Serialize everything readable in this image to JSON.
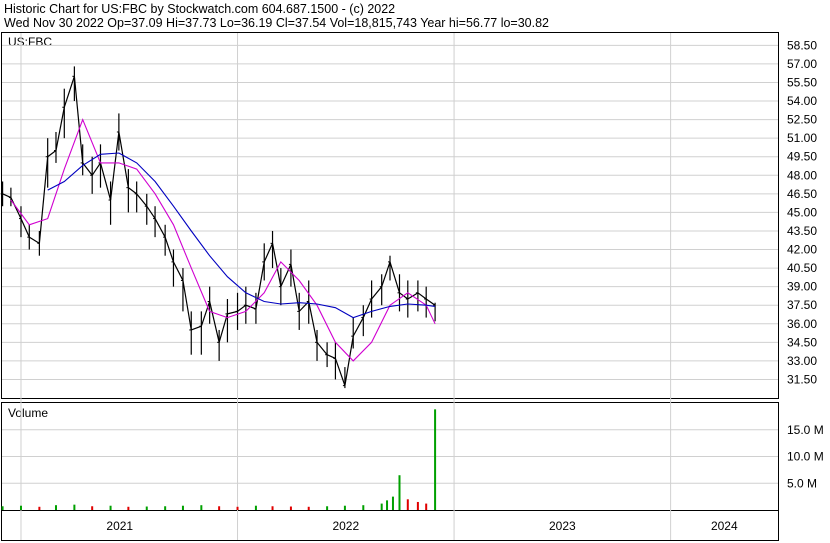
{
  "header": {
    "line1": "Historic Chart for US:FBC by Stockwatch.com 604.687.1500 - (c) 2022",
    "line2": "Wed Nov 30 2022   Op=37.09  Hi=37.73  Lo=36.19  Cl=37.54  Vol=18,815,743  Year hi=56.77  lo=30.82"
  },
  "chart_data": [
    {
      "type": "line",
      "title": "US:FBC",
      "subtype": "daily hi-lo bars with moving averages",
      "x_range": [
        "2020-11-30",
        "2024-06-30"
      ],
      "ylim": [
        30.0,
        59.5
      ],
      "y_ticks": [
        "58.50",
        "57.00",
        "55.50",
        "54.00",
        "52.50",
        "51.00",
        "49.50",
        "48.00",
        "46.50",
        "45.00",
        "43.50",
        "42.00",
        "40.50",
        "39.00",
        "37.50",
        "36.00",
        "34.50",
        "33.00",
        "31.50"
      ],
      "grid": true,
      "series": [
        {
          "style": "hi-lo bars",
          "color": "#000000",
          "x": [
            "2020-12-01",
            "2020-12-15",
            "2021-01-01",
            "2021-01-15",
            "2021-02-01",
            "2021-02-15",
            "2021-03-01",
            "2021-03-15",
            "2021-04-01",
            "2021-04-15",
            "2021-05-01",
            "2021-05-15",
            "2021-06-01",
            "2021-06-15",
            "2021-07-01",
            "2021-07-15",
            "2021-08-01",
            "2021-08-15",
            "2021-09-01",
            "2021-09-15",
            "2021-10-01",
            "2021-10-15",
            "2021-11-01",
            "2021-11-15",
            "2021-12-01",
            "2021-12-15",
            "2022-01-01",
            "2022-01-15",
            "2022-02-01",
            "2022-02-15",
            "2022-03-01",
            "2022-03-15",
            "2022-04-01",
            "2022-04-15",
            "2022-05-01",
            "2022-05-15",
            "2022-06-01",
            "2022-06-15",
            "2022-07-01",
            "2022-07-15",
            "2022-08-01",
            "2022-08-15",
            "2022-09-01",
            "2022-09-15",
            "2022-10-01",
            "2022-10-15",
            "2022-11-01",
            "2022-11-15",
            "2022-11-30"
          ],
          "values": [
            46.5,
            46.2,
            44.5,
            43.0,
            42.5,
            49.5,
            50.0,
            53.5,
            56.0,
            49.0,
            48.0,
            49.0,
            46.0,
            51.5,
            47.0,
            46.5,
            45.5,
            44.5,
            43.0,
            41.0,
            39.5,
            35.5,
            35.8,
            37.8,
            34.5,
            36.8,
            37.0,
            37.5,
            37.2,
            41.0,
            42.5,
            39.0,
            40.8,
            37.0,
            37.8,
            34.5,
            33.5,
            33.2,
            31.0,
            35.0,
            36.5,
            38.0,
            39.0,
            41.0,
            38.5,
            38.0,
            38.5,
            38.0,
            37.5
          ],
          "lows": [
            45.5,
            45.5,
            43.0,
            42.0,
            41.5,
            47.0,
            49.0,
            51.0,
            54.0,
            48.0,
            46.5,
            47.0,
            44.0,
            50.0,
            45.0,
            45.0,
            44.0,
            43.0,
            41.5,
            39.0,
            37.0,
            33.5,
            33.5,
            36.0,
            33.0,
            34.5,
            35.5,
            36.0,
            36.0,
            39.5,
            40.5,
            37.5,
            39.0,
            35.5,
            36.0,
            33.0,
            32.5,
            31.5,
            30.8,
            34.0,
            35.0,
            36.5,
            37.5,
            39.5,
            37.0,
            36.5,
            37.0,
            36.5,
            36.2
          ],
          "highs": [
            47.5,
            47.0,
            45.5,
            44.0,
            43.5,
            51.0,
            51.5,
            55.0,
            56.8,
            50.5,
            49.5,
            50.5,
            47.5,
            53.0,
            48.5,
            47.5,
            46.5,
            45.5,
            44.0,
            42.0,
            40.5,
            37.0,
            37.0,
            39.0,
            35.5,
            38.0,
            38.5,
            39.0,
            38.5,
            42.5,
            43.5,
            40.5,
            42.0,
            38.5,
            39.5,
            35.5,
            34.5,
            34.5,
            32.5,
            36.5,
            37.5,
            39.5,
            40.0,
            41.5,
            40.0,
            39.5,
            39.5,
            39.0,
            37.7
          ]
        },
        {
          "style": "moving average",
          "color": "#d000d0",
          "x": [
            "2020-12-15",
            "2021-01-15",
            "2021-02-15",
            "2021-03-15",
            "2021-04-15",
            "2021-05-15",
            "2021-06-15",
            "2021-07-15",
            "2021-08-15",
            "2021-09-15",
            "2021-10-15",
            "2021-11-15",
            "2021-12-15",
            "2022-01-15",
            "2022-02-15",
            "2022-03-15",
            "2022-04-15",
            "2022-05-15",
            "2022-06-15",
            "2022-07-15",
            "2022-08-15",
            "2022-09-15",
            "2022-10-15",
            "2022-11-15",
            "2022-11-30"
          ],
          "values": [
            46.0,
            44.0,
            44.5,
            48.5,
            52.5,
            49.0,
            49.0,
            48.5,
            46.5,
            44.0,
            40.5,
            37.0,
            36.5,
            37.0,
            38.5,
            41.0,
            39.5,
            37.5,
            34.5,
            33.0,
            34.5,
            37.5,
            38.5,
            37.5,
            36.0
          ]
        },
        {
          "style": "moving average",
          "color": "#0000c0",
          "x": [
            "2021-02-15",
            "2021-03-15",
            "2021-04-15",
            "2021-05-15",
            "2021-06-15",
            "2021-07-15",
            "2021-08-15",
            "2021-09-15",
            "2021-10-15",
            "2021-11-15",
            "2021-12-15",
            "2022-01-15",
            "2022-02-15",
            "2022-03-15",
            "2022-04-15",
            "2022-05-15",
            "2022-06-15",
            "2022-07-15",
            "2022-08-15",
            "2022-09-15",
            "2022-10-15",
            "2022-11-15",
            "2022-11-30"
          ],
          "values": [
            46.8,
            47.5,
            48.8,
            49.7,
            49.8,
            49.0,
            47.5,
            45.5,
            43.5,
            41.5,
            39.8,
            38.5,
            37.8,
            37.6,
            37.7,
            37.6,
            37.3,
            36.5,
            37.0,
            37.4,
            37.6,
            37.5,
            37.4
          ]
        }
      ]
    },
    {
      "type": "bar",
      "title": "Volume",
      "ylim": [
        0,
        20000000
      ],
      "y_ticks": [
        "15.0 M",
        "10.0 M",
        "5.0 M"
      ],
      "grid": true,
      "x": [
        "2020-12-01",
        "2021-01-01",
        "2021-02-01",
        "2021-03-01",
        "2021-04-01",
        "2021-05-01",
        "2021-06-01",
        "2021-07-01",
        "2021-08-01",
        "2021-09-01",
        "2021-10-01",
        "2021-11-01",
        "2021-12-01",
        "2022-01-01",
        "2022-02-01",
        "2022-03-01",
        "2022-04-01",
        "2022-05-01",
        "2022-06-01",
        "2022-07-01",
        "2022-08-01",
        "2022-09-01",
        "2022-09-10",
        "2022-09-20",
        "2022-10-01",
        "2022-10-15",
        "2022-11-01",
        "2022-11-15",
        "2022-11-30"
      ],
      "values": [
        700000,
        800000,
        600000,
        900000,
        1000000,
        700000,
        800000,
        600000,
        650000,
        700000,
        800000,
        900000,
        700000,
        600000,
        800000,
        700000,
        650000,
        600000,
        700000,
        800000,
        900000,
        1200000,
        1800000,
        2500000,
        6500000,
        2000000,
        1500000,
        1200000,
        18815743
      ],
      "up_color": "#00a000",
      "down_color": "#e00000"
    }
  ],
  "x_axis": {
    "labels": [
      "2021",
      "2022",
      "2023",
      "2024"
    ]
  }
}
